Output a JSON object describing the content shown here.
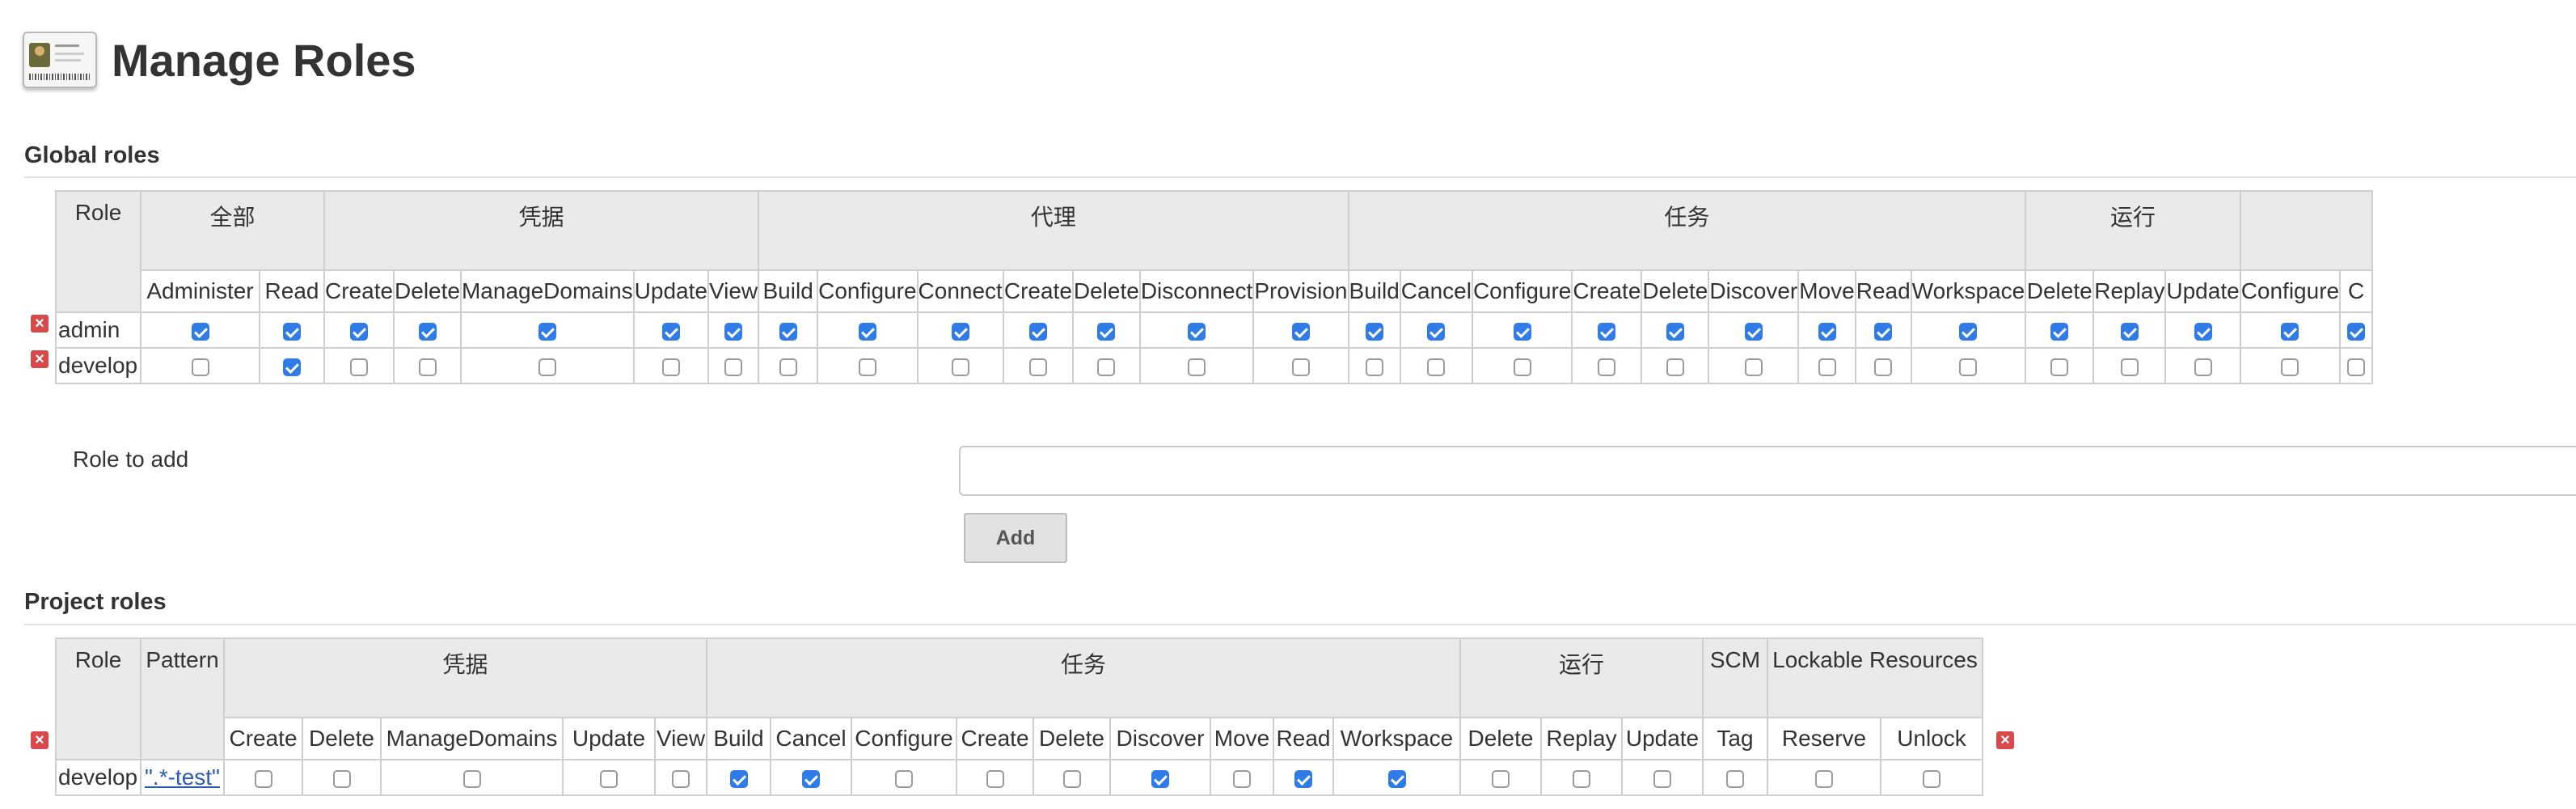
{
  "page": {
    "title": "Manage Roles"
  },
  "global_roles": {
    "title": "Global roles",
    "role_header": "Role",
    "groups": [
      {
        "name": "全部",
        "permissions": [
          "Administer",
          "Read"
        ]
      },
      {
        "name": "凭据",
        "permissions": [
          "Create",
          "Delete",
          "ManageDomains",
          "Update",
          "View"
        ]
      },
      {
        "name": "代理",
        "permissions": [
          "Build",
          "Configure",
          "Connect",
          "Create",
          "Delete",
          "Disconnect",
          "Provision"
        ]
      },
      {
        "name": "任务",
        "permissions": [
          "Build",
          "Cancel",
          "Configure",
          "Create",
          "Delete",
          "Discover",
          "Move",
          "Read",
          "Workspace"
        ]
      },
      {
        "name": "运行",
        "permissions": [
          "Delete",
          "Replay",
          "Update"
        ]
      },
      {
        "name": "",
        "permissions": [
          "Configure",
          "C"
        ]
      }
    ],
    "rows": [
      {
        "role": "admin",
        "checks": [
          true,
          true,
          true,
          true,
          true,
          true,
          true,
          true,
          true,
          true,
          true,
          true,
          true,
          true,
          true,
          true,
          true,
          true,
          true,
          true,
          true,
          true,
          true,
          true,
          true,
          true,
          true,
          true
        ]
      },
      {
        "role": "develop",
        "checks": [
          false,
          true,
          false,
          false,
          false,
          false,
          false,
          false,
          false,
          false,
          false,
          false,
          false,
          false,
          false,
          false,
          false,
          false,
          false,
          false,
          false,
          false,
          false,
          false,
          false,
          false,
          false,
          false
        ]
      }
    ]
  },
  "add_role": {
    "label": "Role to add",
    "value": "",
    "button": "Add"
  },
  "project_roles": {
    "title": "Project roles",
    "role_header": "Role",
    "pattern_header": "Pattern",
    "groups": [
      {
        "name": "凭据",
        "permissions": [
          "Create",
          "Delete",
          "ManageDomains",
          "Update",
          "View"
        ]
      },
      {
        "name": "任务",
        "permissions": [
          "Build",
          "Cancel",
          "Configure",
          "Create",
          "Delete",
          "Discover",
          "Move",
          "Read",
          "Workspace"
        ]
      },
      {
        "name": "运行",
        "permissions": [
          "Delete",
          "Replay",
          "Update"
        ]
      },
      {
        "name": "SCM",
        "permissions": [
          "Tag"
        ]
      },
      {
        "name": "Lockable Resources",
        "permissions": [
          "Reserve",
          "Unlock"
        ]
      }
    ],
    "rows": [
      {
        "role": "develop",
        "pattern": "\".*-test\"",
        "checks": [
          false,
          false,
          false,
          false,
          false,
          true,
          true,
          false,
          false,
          false,
          true,
          false,
          true,
          true,
          false,
          false,
          false,
          false,
          false,
          false
        ]
      }
    ]
  },
  "colors": {
    "checked": "#2f7be8",
    "header_bg": "#eaeaea",
    "delete_icon": "#d84a4a",
    "link": "#2a5db0"
  }
}
